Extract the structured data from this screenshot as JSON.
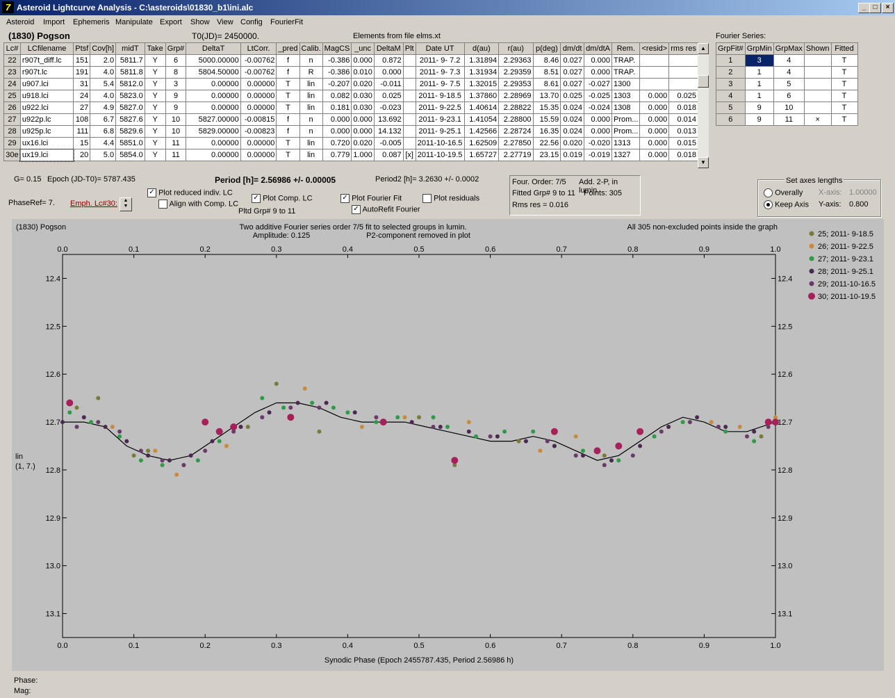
{
  "window": {
    "title": "Asteroid Lightcurve Analysis - C:\\asteroids\\01830_b1\\ini.alc",
    "logo": "7",
    "min": "_",
    "max": "□",
    "close": "×"
  },
  "menu": [
    "Asteroid",
    "Import",
    "Ephemeris",
    "Manipulate",
    "Export",
    "Show",
    "View",
    "Config",
    "FourierFit"
  ],
  "header": {
    "object": "(1830) Pogson",
    "t0": "T0(JD)= 2450000.",
    "elements": "Elements from file elms.xt",
    "fourier_title": "Fourier Series:"
  },
  "lc_table": {
    "columns": [
      "Lc#",
      "LCfilename",
      "Ptsf",
      "Cov[h]",
      "midT",
      "Take",
      "Grp#",
      "DeltaT",
      "LtCorr.",
      "_pred",
      "Calib.",
      "MagCS",
      "_unc",
      "DeltaM",
      "Plt",
      "Date UT",
      "d(au)",
      "r(au)",
      "p(deg)",
      "dm/dt",
      "dm/dtA",
      "Rem.",
      "<resid>",
      "rms res"
    ],
    "rows": [
      [
        "22",
        "r907t_diff.lc",
        "151",
        "2.0",
        "5811.7",
        "Y",
        "6",
        "5000.00000",
        "-0.00762",
        "f",
        "n",
        "-0.386",
        "0.000",
        "0.872",
        "",
        "2011- 9- 7.2",
        "1.31894",
        "2.29363",
        "8.46",
        "0.027",
        "0.000",
        "TRAP.",
        "",
        ""
      ],
      [
        "23",
        "r907t.lc",
        "191",
        "4.0",
        "5811.8",
        "Y",
        "8",
        "5804.50000",
        "-0.00762",
        "f",
        "R",
        "-0.386",
        "0.010",
        "0.000",
        "",
        "2011- 9- 7.3",
        "1.31934",
        "2.29359",
        "8.51",
        "0.027",
        "0.000",
        "TRAP.",
        "",
        ""
      ],
      [
        "24",
        "u907.lci",
        "31",
        "5.4",
        "5812.0",
        "Y",
        "3",
        "0.00000",
        "0.00000",
        "T",
        "lin",
        "-0.207",
        "0.020",
        "-0.011",
        "",
        "2011- 9- 7.5",
        "1.32015",
        "2.29353",
        "8.61",
        "0.027",
        "-0.027",
        "1300",
        "",
        ""
      ],
      [
        "25",
        "u918.lci",
        "24",
        "4.0",
        "5823.0",
        "Y",
        "9",
        "0.00000",
        "0.00000",
        "T",
        "lin",
        "0.082",
        "0.030",
        "0.025",
        "",
        "2011- 9-18.5",
        "1.37860",
        "2.28969",
        "13.70",
        "0.025",
        "-0.025",
        "1303",
        "0.000",
        "0.025"
      ],
      [
        "26",
        "u922.lci",
        "27",
        "4.9",
        "5827.0",
        "Y",
        "9",
        "0.00000",
        "0.00000",
        "T",
        "lin",
        "0.181",
        "0.030",
        "-0.023",
        "",
        "2011- 9-22.5",
        "1.40614",
        "2.28822",
        "15.35",
        "0.024",
        "-0.024",
        "1308",
        "0.000",
        "0.018"
      ],
      [
        "27",
        "u922p.lc",
        "108",
        "6.7",
        "5827.6",
        "Y",
        "10",
        "5827.00000",
        "-0.00815",
        "f",
        "n",
        "0.000",
        "0.000",
        "13.692",
        "",
        "2011- 9-23.1",
        "1.41054",
        "2.28800",
        "15.59",
        "0.024",
        "0.000",
        "Prom...",
        "0.000",
        "0.014"
      ],
      [
        "28",
        "u925p.lc",
        "111",
        "6.8",
        "5829.6",
        "Y",
        "10",
        "5829.00000",
        "-0.00823",
        "f",
        "n",
        "0.000",
        "0.000",
        "14.132",
        "",
        "2011- 9-25.1",
        "1.42566",
        "2.28724",
        "16.35",
        "0.024",
        "0.000",
        "Prom...",
        "0.000",
        "0.013"
      ],
      [
        "29",
        "ux16.lci",
        "15",
        "4.4",
        "5851.0",
        "Y",
        "11",
        "0.00000",
        "0.00000",
        "T",
        "lin",
        "0.720",
        "0.020",
        "-0.005",
        "",
        "2011-10-16.5",
        "1.62509",
        "2.27850",
        "22.56",
        "0.020",
        "-0.020",
        "1313",
        "0.000",
        "0.015"
      ],
      [
        "30e",
        "ux19.lci",
        "20",
        "5.0",
        "5854.0",
        "Y",
        "11",
        "0.00000",
        "0.00000",
        "T",
        "lin",
        "0.779",
        "1.000",
        "0.087",
        "[x]",
        "2011-10-19.5",
        "1.65727",
        "2.27719",
        "23.15",
        "0.019",
        "-0.019",
        "1327",
        "0.000",
        "0.018"
      ]
    ]
  },
  "fourier_table": {
    "columns": [
      "GrpFit#",
      "GrpMin",
      "GrpMax",
      "Shown",
      "Fitted"
    ],
    "rows": [
      [
        "1",
        "3",
        "4",
        "",
        "T"
      ],
      [
        "2",
        "1",
        "4",
        "",
        "T"
      ],
      [
        "3",
        "1",
        "5",
        "",
        "T"
      ],
      [
        "4",
        "1",
        "6",
        "",
        "T"
      ],
      [
        "5",
        "9",
        "10",
        "",
        "T"
      ],
      [
        "6",
        "9",
        "11",
        "×",
        "T"
      ]
    ]
  },
  "params": {
    "g": "G= 0.15",
    "epoch": "Epoch (JD-T0)= 5787.435",
    "period": "Period [h]= 2.56986 +/- 0.00005",
    "period2": "Period2 [h]= 3.2630 +/- 0.0002",
    "phaseref": "PhaseRef= 7.",
    "emph": "Emph. Lc#30:",
    "pltd": "Pltd Grp#  9   to   11",
    "plot_reduced": "Plot reduced indiv. LC",
    "align": "Align with Comp. LC",
    "plot_comp": "Plot Comp. LC",
    "plot_fourier": "Plot Fourier Fit",
    "autorefit": "AutoRefit Fourier",
    "plot_residuals": "Plot residuals"
  },
  "info": {
    "order": "Four. Order:  7/5",
    "add": "Add. 2-P, in lumin.",
    "fitted": "Fitted Grp# 9 to 11",
    "points": "Points: 305",
    "rms": "Rms res     = 0.016"
  },
  "axes_box": {
    "title": "Set axes lengths",
    "overally": "Overally",
    "keep": "Keep Axis",
    "xaxis_label": "X-axis:",
    "xaxis_val": "1.00000",
    "yaxis_label": "Y-axis:",
    "yaxis_val": "0.800"
  },
  "plot_text": {
    "name": "(1830) Pogson",
    "line1": "Two additive Fourier series order 7/5 fit to selected groups in lumin.",
    "amp": "Amplitude: 0.125",
    "p2": "P2-component removed in plot",
    "allpts": "All 305 non-excluded points inside the graph",
    "ylab1": "lin",
    "ylab2": "(1, 7.)",
    "phase": "Phase:",
    "mag": "Mag:"
  },
  "colors": {
    "s25": "#7a7a3a",
    "s26": "#c88a3c",
    "s27": "#2f9a48",
    "s28": "#4a2a52",
    "s29": "#6a3a6a",
    "s30": "#a6205a"
  },
  "chart_data": {
    "type": "scatter",
    "xlabel": "Synodic Phase (Epoch 2455787.435, Period 2.56986 h)",
    "ylabel": "",
    "xlim": [
      0,
      1
    ],
    "ylim": [
      12.35,
      13.15
    ],
    "xticks": [
      "0.0",
      "0.1",
      "0.2",
      "0.3",
      "0.4",
      "0.5",
      "0.6",
      "0.7",
      "0.8",
      "0.9",
      "1.0"
    ],
    "yticks": [
      "12.4",
      "12.5",
      "12.6",
      "12.7",
      "12.8",
      "12.9",
      "13.0",
      "13.1"
    ],
    "ytick_values": [
      12.4,
      12.5,
      12.6,
      12.7,
      12.8,
      12.9,
      13.0,
      13.1
    ],
    "legend_position": "right",
    "fit_curve": {
      "x": [
        0,
        0.03,
        0.06,
        0.09,
        0.12,
        0.15,
        0.18,
        0.21,
        0.24,
        0.27,
        0.3,
        0.33,
        0.36,
        0.39,
        0.42,
        0.45,
        0.48,
        0.51,
        0.54,
        0.57,
        0.6,
        0.63,
        0.66,
        0.69,
        0.72,
        0.75,
        0.78,
        0.81,
        0.84,
        0.87,
        0.9,
        0.93,
        0.96,
        1.0
      ],
      "y": [
        12.7,
        12.7,
        12.71,
        12.75,
        12.77,
        12.78,
        12.77,
        12.74,
        12.71,
        12.68,
        12.66,
        12.66,
        12.67,
        12.69,
        12.7,
        12.7,
        12.7,
        12.71,
        12.72,
        12.73,
        12.74,
        12.74,
        12.73,
        12.74,
        12.76,
        12.78,
        12.77,
        12.74,
        12.71,
        12.69,
        12.7,
        12.72,
        12.72,
        12.7
      ]
    },
    "series": [
      {
        "name": "25; 2011- 9-18.5",
        "x": [
          0.02,
          0.05,
          0.1,
          0.12,
          0.17,
          0.26,
          0.3,
          0.36,
          0.5,
          0.55,
          0.64,
          0.76,
          0.92,
          0.98
        ],
        "y": [
          12.67,
          12.65,
          12.77,
          12.76,
          12.79,
          12.71,
          12.62,
          12.72,
          12.69,
          12.79,
          12.74,
          12.77,
          12.71,
          12.73
        ]
      },
      {
        "name": "26; 2011- 9-22.5",
        "x": [
          0.07,
          0.13,
          0.16,
          0.23,
          0.32,
          0.34,
          0.42,
          0.48,
          0.57,
          0.61,
          0.67,
          0.72,
          0.85,
          0.91,
          0.95,
          1.0
        ],
        "y": [
          12.71,
          12.76,
          12.81,
          12.75,
          12.69,
          12.63,
          12.71,
          12.69,
          12.7,
          12.73,
          12.76,
          12.73,
          12.71,
          12.7,
          12.71,
          12.69
        ]
      },
      {
        "name": "27; 2011- 9-23.1",
        "x": [
          0.01,
          0.04,
          0.08,
          0.11,
          0.14,
          0.19,
          0.22,
          0.28,
          0.31,
          0.35,
          0.38,
          0.4,
          0.44,
          0.47,
          0.52,
          0.54,
          0.58,
          0.62,
          0.66,
          0.69,
          0.73,
          0.78,
          0.83,
          0.87,
          0.93,
          0.97
        ],
        "y": [
          12.68,
          12.7,
          12.73,
          12.78,
          12.79,
          12.78,
          12.74,
          12.65,
          12.67,
          12.66,
          12.67,
          12.68,
          12.7,
          12.69,
          12.69,
          12.71,
          12.73,
          12.72,
          12.72,
          12.75,
          12.76,
          12.78,
          12.73,
          12.7,
          12.72,
          12.74
        ]
      },
      {
        "name": "28; 2011- 9-25.1",
        "x": [
          0.0,
          0.03,
          0.06,
          0.09,
          0.12,
          0.15,
          0.18,
          0.21,
          0.25,
          0.29,
          0.33,
          0.37,
          0.41,
          0.45,
          0.49,
          0.53,
          0.57,
          0.61,
          0.65,
          0.69,
          0.73,
          0.77,
          0.81,
          0.85,
          0.89,
          0.93,
          0.97
        ],
        "y": [
          12.7,
          12.69,
          12.71,
          12.74,
          12.77,
          12.78,
          12.77,
          12.74,
          12.71,
          12.68,
          12.66,
          12.66,
          12.68,
          12.7,
          12.7,
          12.71,
          12.72,
          12.73,
          12.74,
          12.75,
          12.77,
          12.78,
          12.75,
          12.71,
          12.69,
          12.71,
          12.72
        ]
      },
      {
        "name": "29; 2011-10-16.5",
        "x": [
          0.02,
          0.05,
          0.08,
          0.11,
          0.14,
          0.17,
          0.2,
          0.24,
          0.28,
          0.32,
          0.36,
          0.44,
          0.52,
          0.6,
          0.68,
          0.72,
          0.76,
          0.8,
          0.84,
          0.88,
          0.92,
          0.96,
          0.99
        ],
        "y": [
          12.71,
          12.7,
          12.72,
          12.76,
          12.78,
          12.79,
          12.76,
          12.72,
          12.69,
          12.67,
          12.67,
          12.69,
          12.71,
          12.73,
          12.74,
          12.77,
          12.79,
          12.77,
          12.72,
          12.7,
          12.71,
          12.73,
          12.71
        ]
      },
      {
        "name": "30; 2011-10-19.5",
        "x": [
          0.01,
          0.2,
          0.22,
          0.24,
          0.32,
          0.45,
          0.55,
          0.69,
          0.75,
          0.78,
          0.81,
          0.99,
          1.0
        ],
        "y": [
          12.66,
          12.7,
          12.72,
          12.71,
          12.69,
          12.7,
          12.78,
          12.72,
          12.76,
          12.75,
          12.72,
          12.7,
          12.7
        ]
      }
    ]
  }
}
